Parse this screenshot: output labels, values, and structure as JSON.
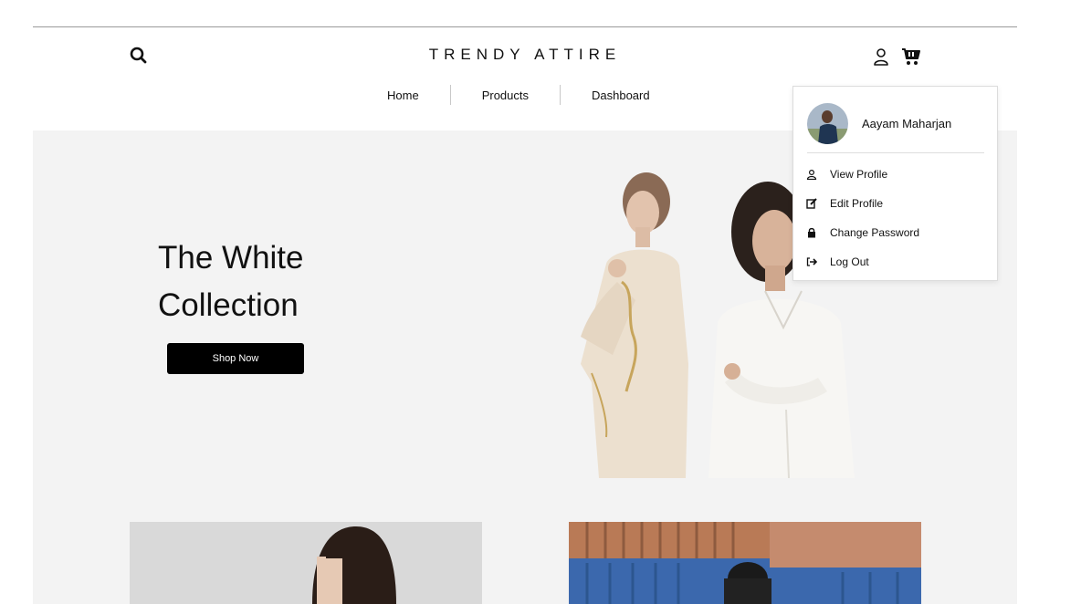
{
  "brand": {
    "name": "TRENDY ATTIRE"
  },
  "header": {
    "search_icon": "search-icon",
    "user_icon": "user-icon",
    "cart_icon": "cart-icon"
  },
  "nav": {
    "items": [
      {
        "label": "Home"
      },
      {
        "label": "Products"
      },
      {
        "label": "Dashboard"
      }
    ]
  },
  "hero": {
    "title_line1": "The White",
    "title_line2": "Collection",
    "cta_label": "Shop Now"
  },
  "user_menu": {
    "name": "Aayam Maharjan",
    "items": [
      {
        "label": "View Profile",
        "icon": "user-icon"
      },
      {
        "label": "Edit Profile",
        "icon": "edit-icon"
      },
      {
        "label": "Change Password",
        "icon": "lock-icon"
      },
      {
        "label": "Log Out",
        "icon": "logout-icon"
      }
    ]
  },
  "colors": {
    "accent": "#000000",
    "hero_bg": "#f3f3f3",
    "button_text": "#ffffff"
  }
}
